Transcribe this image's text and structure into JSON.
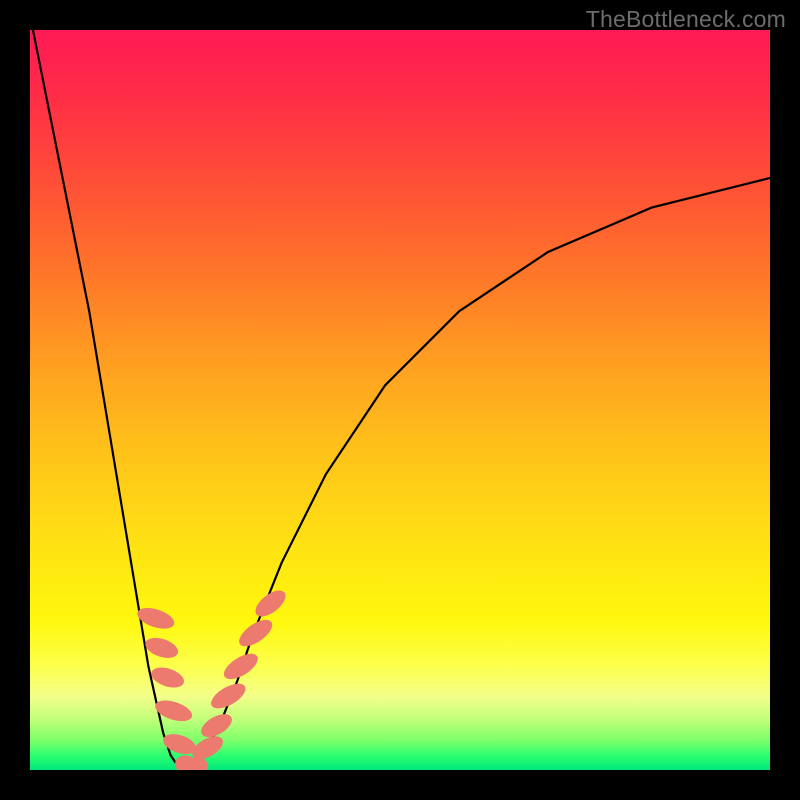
{
  "watermark": "TheBottleneck.com",
  "colors": {
    "background": "#000000",
    "gradient_top": "#ff1a55",
    "gradient_mid": "#ffe313",
    "gradient_bottom": "#00e77a",
    "curve": "#000000",
    "marker": "#ed7a6f"
  },
  "chart_data": {
    "type": "line",
    "title": "",
    "xlabel": "",
    "ylabel": "",
    "xlim": [
      0,
      100
    ],
    "ylim": [
      0,
      100
    ],
    "series": [
      {
        "name": "bottleneck-curve",
        "x": [
          0,
          2,
          4,
          6,
          8,
          10,
          12,
          14,
          16,
          18,
          19,
          20,
          21,
          22,
          23,
          24,
          25,
          26,
          28,
          30,
          34,
          40,
          48,
          58,
          70,
          84,
          100
        ],
        "y": [
          102,
          92,
          82,
          72,
          62,
          50,
          38,
          26,
          14,
          5,
          2,
          0.5,
          0,
          0.5,
          1.5,
          3,
          5,
          7,
          12,
          18,
          28,
          40,
          52,
          62,
          70,
          76,
          80
        ]
      }
    ],
    "markers": [
      {
        "x": 17.0,
        "y": 20.5,
        "rx": 1.2,
        "ry": 2.6,
        "angle": -72
      },
      {
        "x": 17.8,
        "y": 16.5,
        "rx": 1.2,
        "ry": 2.3,
        "angle": -72
      },
      {
        "x": 18.6,
        "y": 12.5,
        "rx": 1.2,
        "ry": 2.3,
        "angle": -72
      },
      {
        "x": 19.4,
        "y": 8.0,
        "rx": 1.2,
        "ry": 2.6,
        "angle": -72
      },
      {
        "x": 20.2,
        "y": 3.5,
        "rx": 1.2,
        "ry": 2.3,
        "angle": -72
      },
      {
        "x": 21.0,
        "y": 0.8,
        "rx": 1.4,
        "ry": 1.2,
        "angle": 0
      },
      {
        "x": 22.6,
        "y": 0.6,
        "rx": 1.4,
        "ry": 1.2,
        "angle": 0
      },
      {
        "x": 24.0,
        "y": 3.0,
        "rx": 1.2,
        "ry": 2.3,
        "angle": 60
      },
      {
        "x": 25.2,
        "y": 6.0,
        "rx": 1.2,
        "ry": 2.3,
        "angle": 60
      },
      {
        "x": 26.8,
        "y": 10.0,
        "rx": 1.2,
        "ry": 2.6,
        "angle": 60
      },
      {
        "x": 28.5,
        "y": 14.0,
        "rx": 1.2,
        "ry": 2.6,
        "angle": 58
      },
      {
        "x": 30.5,
        "y": 18.5,
        "rx": 1.2,
        "ry": 2.6,
        "angle": 55
      },
      {
        "x": 32.5,
        "y": 22.5,
        "rx": 1.2,
        "ry": 2.4,
        "angle": 52
      }
    ]
  }
}
